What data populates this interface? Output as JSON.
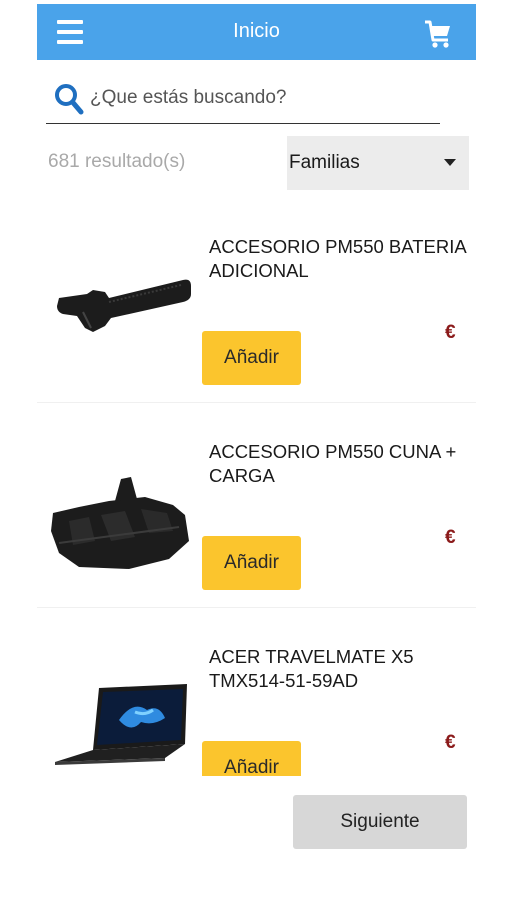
{
  "header": {
    "title": "Inicio",
    "menu_icon": "hamburger-menu-icon",
    "cart_icon": "shopping-cart-icon"
  },
  "search": {
    "placeholder": "¿Que estás buscando?",
    "value": "",
    "icon": "search-icon"
  },
  "results": {
    "count_text": "681 resultado(s)"
  },
  "filter": {
    "selected": "Familias",
    "icon": "caret-down-icon"
  },
  "products": [
    {
      "name": "ACCESORIO PM550 BATERIA ADICIONAL",
      "add_label": "Añadir",
      "price": "€",
      "image": "battery-image"
    },
    {
      "name": "ACCESORIO PM550 CUNA + CARGA",
      "add_label": "Añadir",
      "price": "€",
      "image": "charging-cradle-image"
    },
    {
      "name": "ACER TRAVELMATE X5 TMX514-51-59AD",
      "add_label": "Añadir",
      "price": "€",
      "image": "laptop-image"
    }
  ],
  "pagination": {
    "next_label": "Siguiente"
  },
  "colors": {
    "header": "#4aa3ea",
    "accent_button": "#fbc52d",
    "price": "#8b1a1a",
    "search_icon": "#1f6fc0"
  }
}
